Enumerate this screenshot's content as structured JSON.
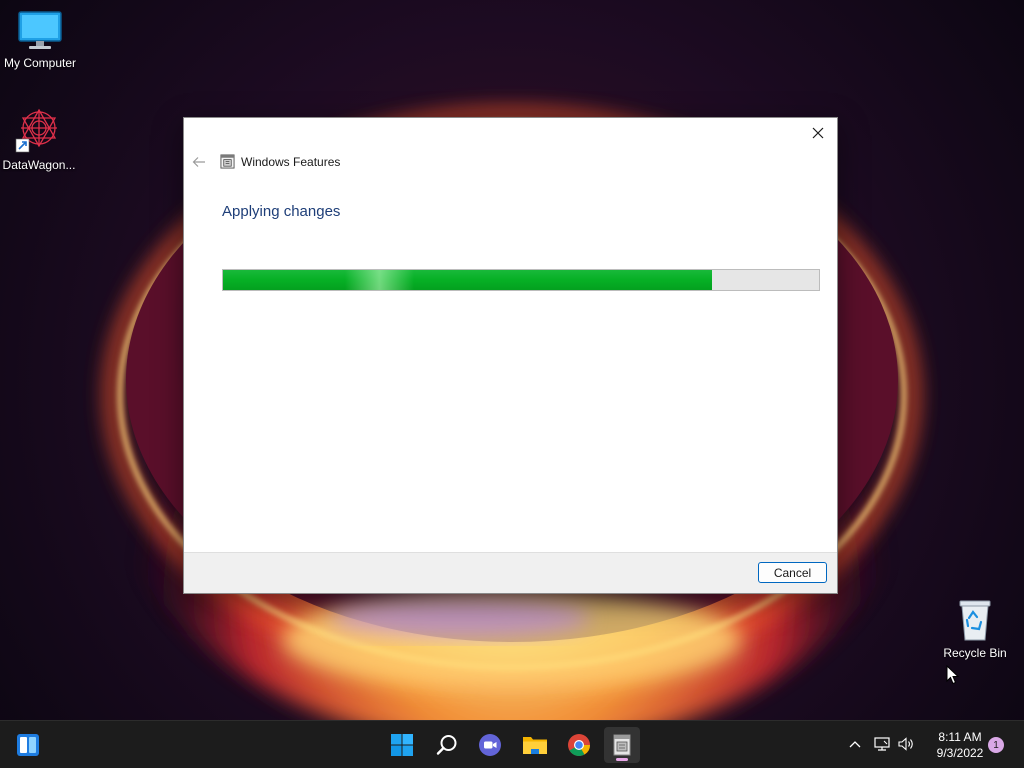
{
  "desktop": {
    "icons": [
      {
        "label": "My Computer",
        "icon": "monitor-icon"
      },
      {
        "label": "DataWagon...",
        "icon": "datawagon-shortcut-icon"
      },
      {
        "label": "Recycle Bin",
        "icon": "recycle-bin-icon"
      }
    ]
  },
  "dialog": {
    "title": "Windows Features",
    "heading": "Applying changes",
    "progress_percent": 82,
    "progress_color": "#06b025",
    "cancel_label": "Cancel"
  },
  "taskbar": {
    "items": [
      {
        "name": "widgets",
        "icon": "widgets-icon"
      },
      {
        "name": "start",
        "icon": "windows-logo-icon"
      },
      {
        "name": "search",
        "icon": "search-icon"
      },
      {
        "name": "chat",
        "icon": "chat-video-icon"
      },
      {
        "name": "file-explorer",
        "icon": "folder-icon"
      },
      {
        "name": "chrome",
        "icon": "chrome-icon"
      },
      {
        "name": "windows-features",
        "icon": "windows-features-icon",
        "active": true
      }
    ],
    "clock": {
      "time": "8:11 AM",
      "date": "9/3/2022"
    },
    "notification_count": "1"
  }
}
